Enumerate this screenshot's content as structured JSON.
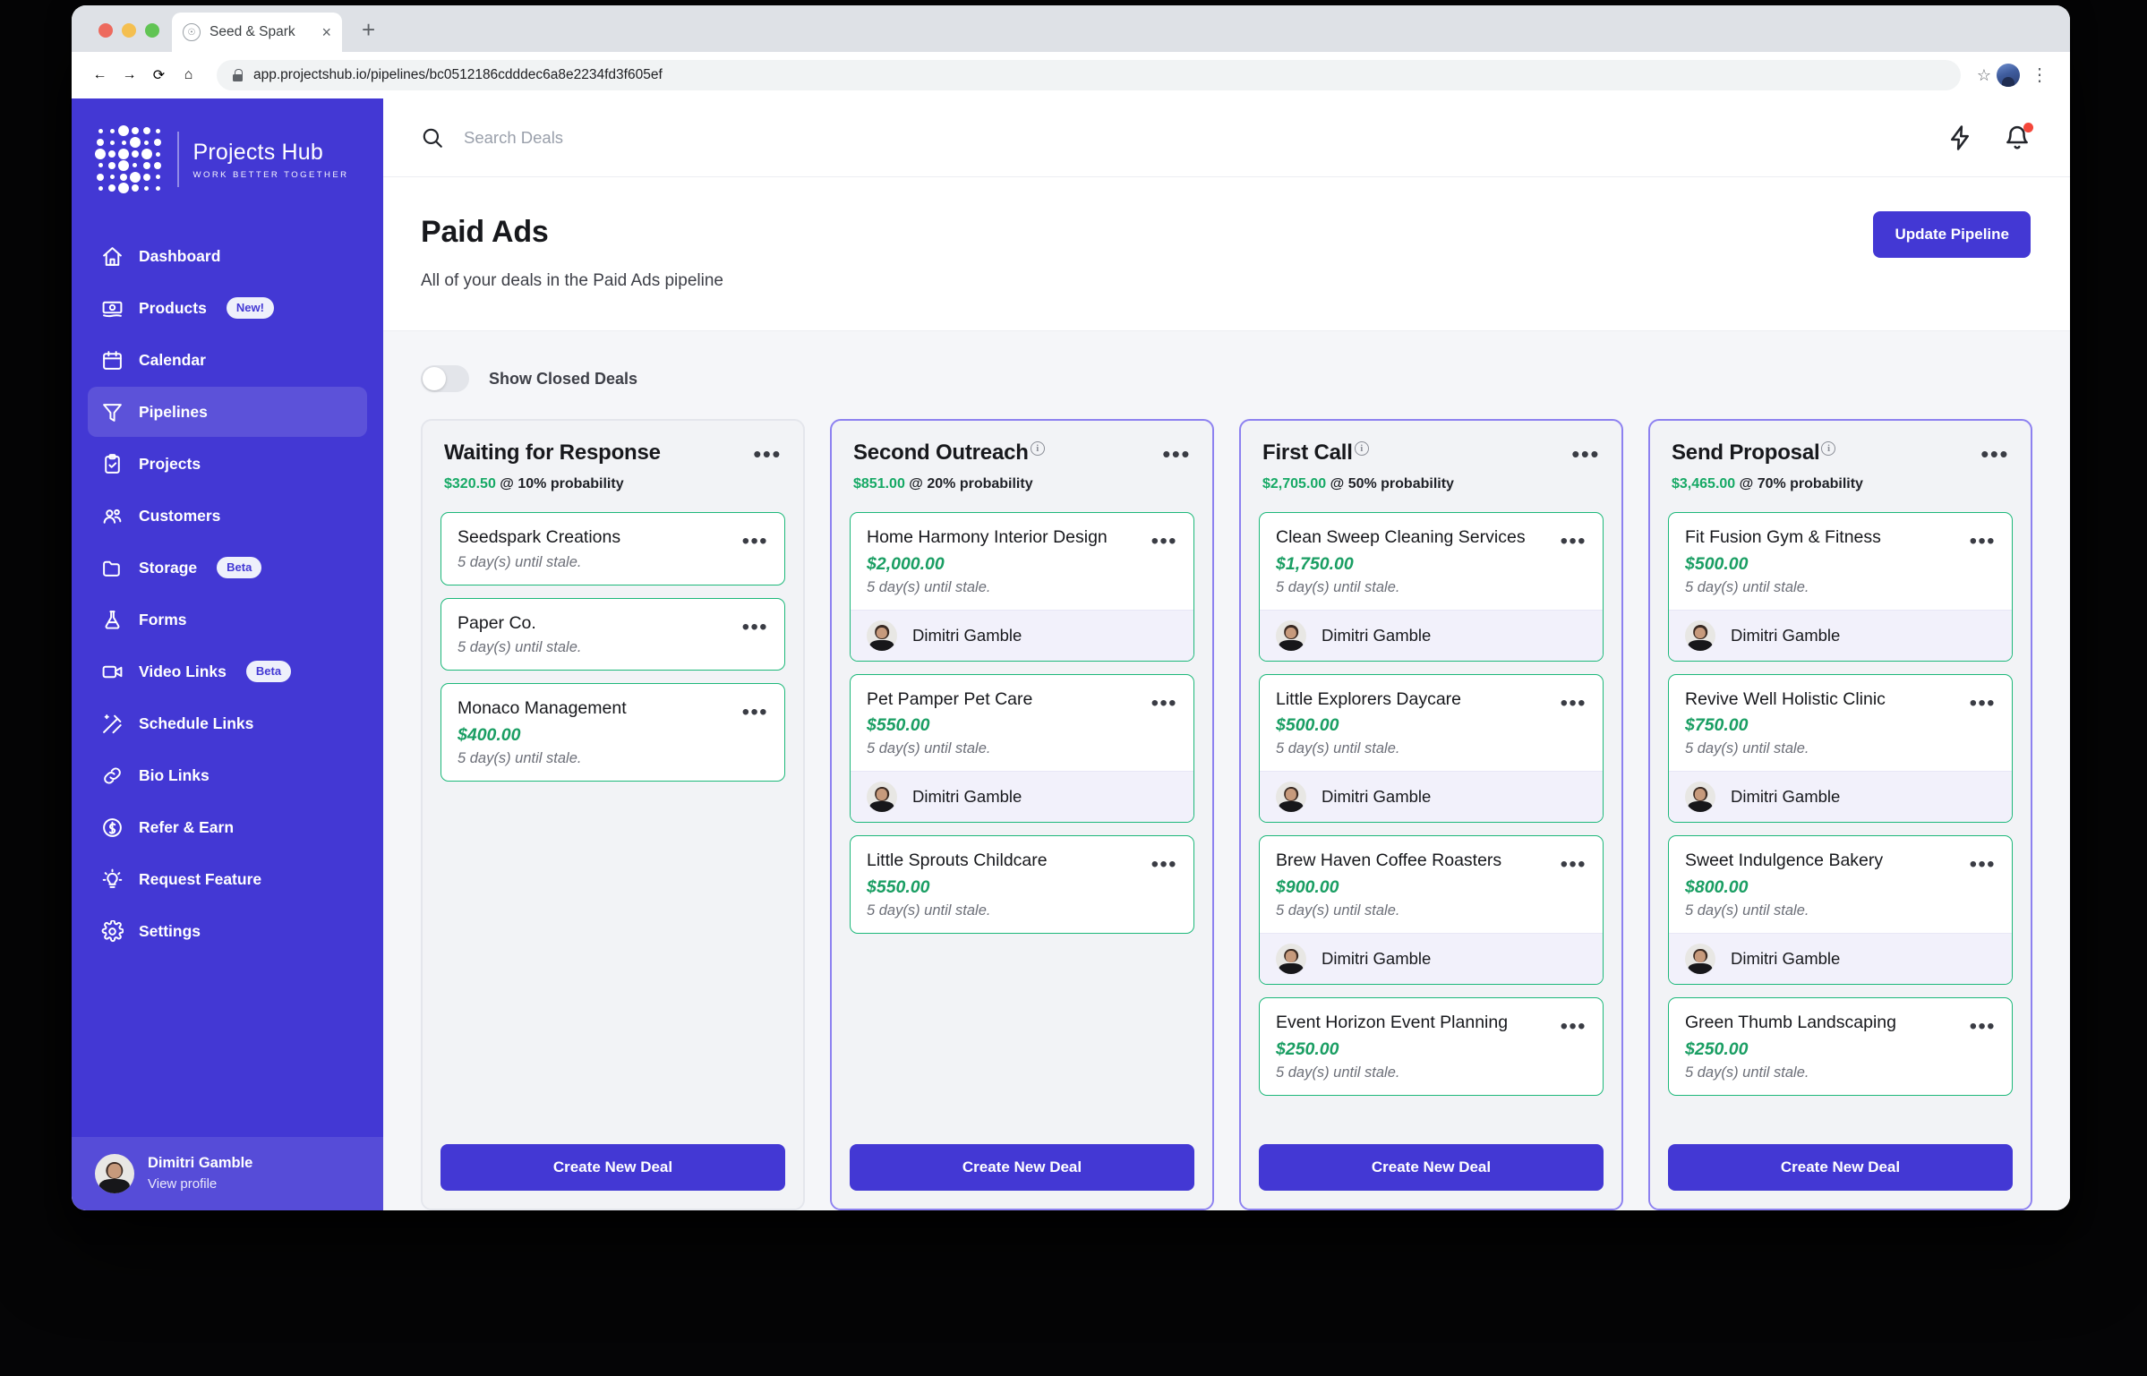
{
  "browser": {
    "tab_title": "Seed & Spark",
    "url": "app.projectshub.io/pipelines/bc0512186cdddec6a8e2234fd3f605ef",
    "new_tab_label": "+",
    "close_tab_label": "×"
  },
  "sidebar": {
    "brand_name": "Projects Hub",
    "brand_tagline": "WORK BETTER TOGETHER",
    "items": [
      {
        "label": "Dashboard",
        "icon": "home-icon",
        "badge": null,
        "active": false
      },
      {
        "label": "Products",
        "icon": "money-icon",
        "badge": "New!",
        "active": false
      },
      {
        "label": "Calendar",
        "icon": "calendar-icon",
        "badge": null,
        "active": false
      },
      {
        "label": "Pipelines",
        "icon": "funnel-icon",
        "badge": null,
        "active": true
      },
      {
        "label": "Projects",
        "icon": "clipboard-check-icon",
        "badge": null,
        "active": false
      },
      {
        "label": "Customers",
        "icon": "users-icon",
        "badge": null,
        "active": false
      },
      {
        "label": "Storage",
        "icon": "folder-icon",
        "badge": "Beta",
        "active": false
      },
      {
        "label": "Forms",
        "icon": "flask-icon",
        "badge": null,
        "active": false
      },
      {
        "label": "Video Links",
        "icon": "video-camera-icon",
        "badge": "Beta",
        "active": false
      },
      {
        "label": "Schedule Links",
        "icon": "wand-icon",
        "badge": null,
        "active": false
      },
      {
        "label": "Bio Links",
        "icon": "link-icon",
        "badge": null,
        "active": false
      },
      {
        "label": "Refer & Earn",
        "icon": "dollar-circle-icon",
        "badge": null,
        "active": false
      },
      {
        "label": "Request Feature",
        "icon": "lightbulb-icon",
        "badge": null,
        "active": false
      },
      {
        "label": "Settings",
        "icon": "gear-icon",
        "badge": null,
        "active": false
      }
    ],
    "user": {
      "name": "Dimitri Gamble",
      "action": "View profile"
    }
  },
  "topbar": {
    "search_placeholder": "Search Deals",
    "search_value": "",
    "bolt_icon": "lightning-icon",
    "bell_icon": "bell-icon",
    "has_notification": true
  },
  "page": {
    "title": "Paid Ads",
    "subtitle": "All of your deals in the Paid Ads pipeline",
    "update_button": "Update Pipeline"
  },
  "board": {
    "show_closed_label": "Show Closed Deals",
    "show_closed_on": false,
    "create_deal_label": "Create New Deal",
    "kebab_glyph": "•••",
    "info_glyph": "i",
    "accent_purple": "#4338d4",
    "accent_green": "#16a965",
    "card_border_green": "#1db87a",
    "columns": [
      {
        "title": "Waiting for Response",
        "has_info": false,
        "highlighted": false,
        "amount": "$320.50",
        "probability_text": "@ 10% probability",
        "cards": [
          {
            "name": "Seedspark Creations",
            "amount": null,
            "stale": "5 day(s) until stale.",
            "owner": null
          },
          {
            "name": "Paper Co.",
            "amount": null,
            "stale": "5 day(s) until stale.",
            "owner": null
          },
          {
            "name": "Monaco Management",
            "amount": "$400.00",
            "stale": "5 day(s) until stale.",
            "owner": null
          }
        ]
      },
      {
        "title": "Second Outreach",
        "has_info": true,
        "highlighted": true,
        "amount": "$851.00",
        "probability_text": "@ 20% probability",
        "cards": [
          {
            "name": "Home Harmony Interior Design",
            "amount": "$2,000.00",
            "stale": "5 day(s) until stale.",
            "owner": "Dimitri Gamble"
          },
          {
            "name": "Pet Pamper Pet Care",
            "amount": "$550.00",
            "stale": "5 day(s) until stale.",
            "owner": "Dimitri Gamble"
          },
          {
            "name": "Little Sprouts Childcare",
            "amount": "$550.00",
            "stale": "5 day(s) until stale.",
            "owner": null
          }
        ]
      },
      {
        "title": "First Call",
        "has_info": true,
        "highlighted": true,
        "amount": "$2,705.00",
        "probability_text": "@ 50% probability",
        "cards": [
          {
            "name": "Clean Sweep Cleaning Services",
            "amount": "$1,750.00",
            "stale": "5 day(s) until stale.",
            "owner": "Dimitri Gamble"
          },
          {
            "name": "Little Explorers Daycare",
            "amount": "$500.00",
            "stale": "5 day(s) until stale.",
            "owner": "Dimitri Gamble"
          },
          {
            "name": "Brew Haven Coffee Roasters",
            "amount": "$900.00",
            "stale": "5 day(s) until stale.",
            "owner": "Dimitri Gamble"
          },
          {
            "name": "Event Horizon Event Planning",
            "amount": "$250.00",
            "stale": "5 day(s) until stale.",
            "owner": null
          }
        ]
      },
      {
        "title": "Send Proposal",
        "has_info": true,
        "highlighted": true,
        "amount": "$3,465.00",
        "probability_text": "@ 70% probability",
        "cards": [
          {
            "name": "Fit Fusion Gym & Fitness",
            "amount": "$500.00",
            "stale": "5 day(s) until stale.",
            "owner": "Dimitri Gamble"
          },
          {
            "name": "Revive Well Holistic Clinic",
            "amount": "$750.00",
            "stale": "5 day(s) until stale.",
            "owner": "Dimitri Gamble"
          },
          {
            "name": "Sweet Indulgence Bakery",
            "amount": "$800.00",
            "stale": "5 day(s) until stale.",
            "owner": "Dimitri Gamble"
          },
          {
            "name": "Green Thumb Landscaping",
            "amount": "$250.00",
            "stale": "5 day(s) until stale.",
            "owner": null
          }
        ]
      }
    ]
  }
}
